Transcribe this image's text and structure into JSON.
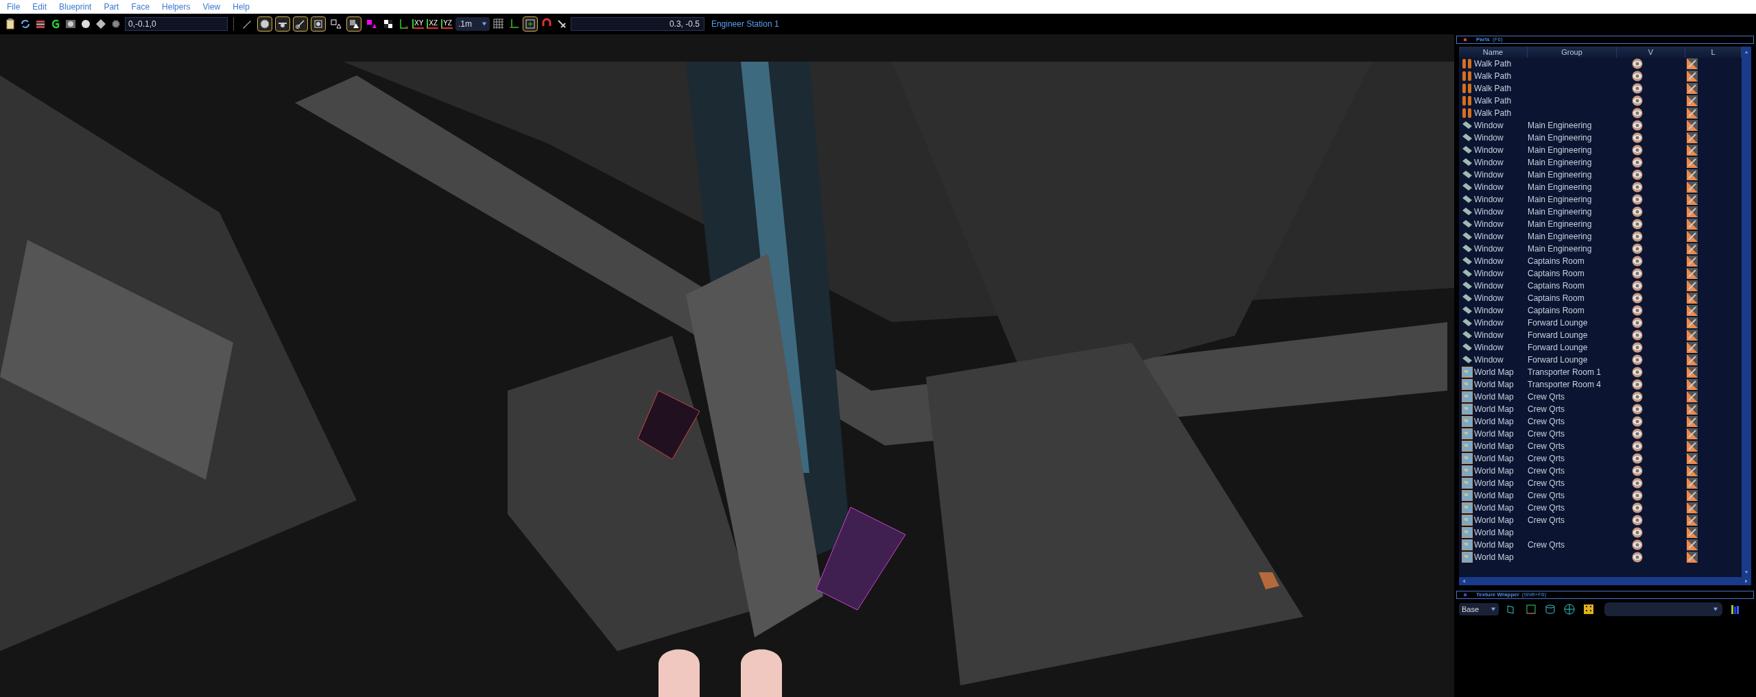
{
  "menu": [
    "File",
    "Edit",
    "Blueprint",
    "Part",
    "Face",
    "Helpers",
    "View",
    "Help"
  ],
  "toolbar": {
    "position": "0,-0.1,0",
    "tools": [
      {
        "selected": false
      },
      {
        "selected": true
      },
      {
        "selected": true
      },
      {
        "selected": true
      },
      {
        "selected": true
      },
      {
        "selected": false
      },
      {
        "selected": true
      },
      {
        "selected": false
      }
    ],
    "axis_planes": [
      "XY",
      "XZ",
      "YZ"
    ],
    "grid_size": ".1m",
    "snap": {
      "selected": true
    },
    "coordinates": "0.3, -0.5",
    "object_name": "Engineer Station 1"
  },
  "parts_panel": {
    "title": "Parts",
    "shortcut": "(F6)",
    "columns": [
      "Name",
      "Group",
      "V",
      "L"
    ],
    "rows": [
      {
        "kind": "walk_path",
        "name": "Walk Path"
      },
      {
        "kind": "walk_path",
        "name": "Walk Path"
      },
      {
        "kind": "walk_path",
        "name": "Walk Path"
      },
      {
        "kind": "walk_path",
        "name": "Walk Path"
      },
      {
        "kind": "walk_path",
        "name": "Walk Path"
      },
      {
        "kind": "window",
        "name": "Window",
        "group": "Main Engineering"
      },
      {
        "kind": "window",
        "name": "Window",
        "group": "Main Engineering"
      },
      {
        "kind": "window",
        "name": "Window",
        "group": "Main Engineering"
      },
      {
        "kind": "window",
        "name": "Window",
        "group": "Main Engineering"
      },
      {
        "kind": "window",
        "name": "Window",
        "group": "Main Engineering"
      },
      {
        "kind": "window",
        "name": "Window",
        "group": "Main Engineering"
      },
      {
        "kind": "window",
        "name": "Window",
        "group": "Main Engineering"
      },
      {
        "kind": "window",
        "name": "Window",
        "group": "Main Engineering"
      },
      {
        "kind": "window",
        "name": "Window",
        "group": "Main Engineering"
      },
      {
        "kind": "window",
        "name": "Window",
        "group": "Main Engineering"
      },
      {
        "kind": "window",
        "name": "Window",
        "group": "Main Engineering"
      },
      {
        "kind": "window",
        "name": "Window",
        "group": "Captains Room"
      },
      {
        "kind": "window",
        "name": "Window",
        "group": "Captains Room"
      },
      {
        "kind": "window",
        "name": "Window",
        "group": "Captains Room"
      },
      {
        "kind": "window",
        "name": "Window",
        "group": "Captains Room"
      },
      {
        "kind": "window",
        "name": "Window",
        "group": "Captains Room"
      },
      {
        "kind": "window",
        "name": "Window",
        "group": "Forward Lounge"
      },
      {
        "kind": "window",
        "name": "Window",
        "group": "Forward Lounge"
      },
      {
        "kind": "window",
        "name": "Window",
        "group": "Forward Lounge"
      },
      {
        "kind": "window",
        "name": "Window",
        "group": "Forward Lounge"
      },
      {
        "kind": "world_map",
        "name": "World Map",
        "group": "Transporter Room 1"
      },
      {
        "kind": "world_map",
        "name": "World Map",
        "group": "Transporter Room 4"
      },
      {
        "kind": "world_map",
        "name": "World Map",
        "group": "Crew Qrts"
      },
      {
        "kind": "world_map",
        "name": "World Map",
        "group": "Crew Qrts"
      },
      {
        "kind": "world_map",
        "name": "World Map",
        "group": "Crew Qrts"
      },
      {
        "kind": "world_map",
        "name": "World Map",
        "group": "Crew Qrts"
      },
      {
        "kind": "world_map",
        "name": "World Map",
        "group": "Crew Qrts"
      },
      {
        "kind": "world_map",
        "name": "World Map",
        "group": "Crew Qrts"
      },
      {
        "kind": "world_map",
        "name": "World Map",
        "group": "Crew Qrts"
      },
      {
        "kind": "world_map",
        "name": "World Map",
        "group": "Crew Qrts"
      },
      {
        "kind": "world_map",
        "name": "World Map",
        "group": "Crew Qrts"
      },
      {
        "kind": "world_map",
        "name": "World Map",
        "group": "Crew Qrts"
      },
      {
        "kind": "world_map",
        "name": "World Map",
        "group": "Crew Qrts"
      },
      {
        "kind": "world_map",
        "name": "World Map"
      },
      {
        "kind": "world_map",
        "name": "World Map",
        "group": "Crew Qrts"
      },
      {
        "kind": "world_map",
        "name": "World Map"
      }
    ]
  },
  "texture_panel": {
    "title": "Texture Wrapper",
    "shortcut": "(Shift+F6)",
    "layer": "Base"
  }
}
